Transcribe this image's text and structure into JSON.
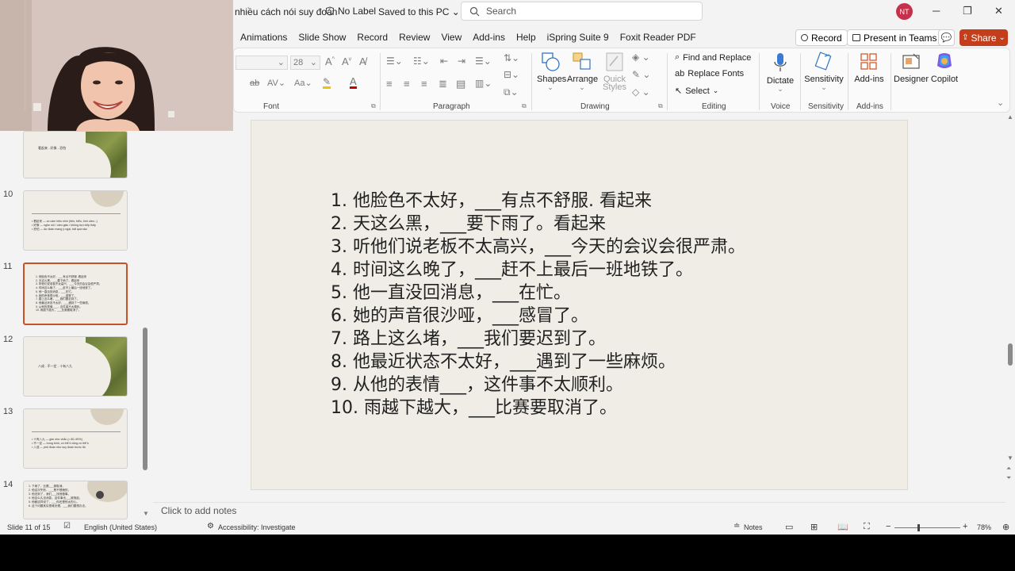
{
  "titlebar": {
    "doc_title": "nhiều cách nói suy đoán",
    "label": "No Label",
    "saved": "Saved to this PC",
    "search_placeholder": "Search",
    "avatar_initials": "NT",
    "minimize": "─",
    "restore": "❐",
    "close": "✕"
  },
  "tabs": [
    "Animations",
    "Slide Show",
    "Record",
    "Review",
    "View",
    "Add-ins",
    "Help",
    "iSpring Suite 9",
    "Foxit Reader PDF"
  ],
  "actions": {
    "record": "Record",
    "present_in_teams": "Present in Teams",
    "share": "Share"
  },
  "ribbon": {
    "font_name": "",
    "font_size": "28",
    "groups": {
      "font": "Font",
      "paragraph": "Paragraph",
      "drawing": "Drawing",
      "editing": "Editing",
      "voice": "Voice",
      "sensitivity": "Sensitivity",
      "addins": "Add-ins"
    },
    "buttons": {
      "shapes": "Shapes",
      "arrange": "Arrange",
      "quick": "Quick",
      "styles": "Styles",
      "find_replace": "Find and Replace",
      "replace_fonts": "Replace Fonts",
      "select": "Select",
      "dictate": "Dictate",
      "sensitivity": "Sensitivity",
      "addins": "Add-ins",
      "designer": "Designer",
      "copilot": "Copilot"
    }
  },
  "thumbnails": {
    "numbers": [
      "10",
      "11",
      "12",
      "13",
      "14"
    ],
    "t9_title": "看起来 - 好像 - 恐怕",
    "t10_lines": "• 看起来 — có cảm hiệu nhìn (tiếu, biểu, tình cảm...)\n• 好像 — nghe nói / cảm giác / không trực tiếp thấy\n• 恐怕 — dự đoán mang ý ngại, bất quá sảo",
    "t11_lines": "1. 他脸色不太好，___有点不舒服. 看起来\n2. 天这么黑，___要下雨了。看起来\n3. 听他们说老板不太高兴，___今天的会议会很严肃。\n4. 时间这么晚了，___赶不上最后一班地铁了。\n5. 他一直没回消息，___在忙。\n6. 她的声音很沙哑，___感冒了。\n7. 路上这么堵，___我们要迟到了。\n8. 他最近状态不太好，___遇到了一些麻烦。\n9. 从他的表情___，这件事不太顺利。\n10. 雨越下越大，___比赛要取消了。",
    "t12_title": "八成 - 不一定 - 十有八九",
    "t13_lines": "• 十有八九 — gần như chắc (≈ 80–90%)\n• 不一定 — trung bình, có thể lí cũng có thể k\n• 八成 — phỏ đoán như suy đoán trước đó",
    "t14_lines": "1. 下雨了，比赛___被取消。\n2. 他这次失败，___是不想赌的。\n3. 他迟到了，我们___找他做事。\n4. 他这么久没消息，这件事也___被拖延。\n5. 他都这样说了，___你还是别太担心。\n6. 这个问题其实很难处理，___我们要想办法。"
  },
  "slide": {
    "sentences": [
      "1. 他脸色不太好，___有点不舒服. 看起来",
      "2. 天这么黑，___要下雨了。看起来",
      "3. 听他们说老板不太高兴，___今天的会议会很严肃。",
      "4. 时间这么晚了，___赶不上最后一班地铁了。",
      "5. 他一直没回消息，___在忙。",
      "6. 她的声音很沙哑，___感冒了。",
      "7. 路上这么堵，___我们要迟到了。",
      "8. 他最近状态不太好，___遇到了一些麻烦。",
      "9. 从他的表情___，这件事不太顺利。",
      "10. 雨越下越大，___比赛要取消了。"
    ]
  },
  "notes_placeholder": "Click to add notes",
  "status": {
    "slide_info": "Slide 11 of 15",
    "language": "English (United States)",
    "accessibility": "Accessibility: Investigate",
    "notes": "Notes",
    "zoom": "78%"
  },
  "colors": {
    "share_button": "#c43e1c",
    "selected_thumb_border": "#c7522a",
    "slide_background": "#efede6",
    "avatar": "#c4314b"
  }
}
